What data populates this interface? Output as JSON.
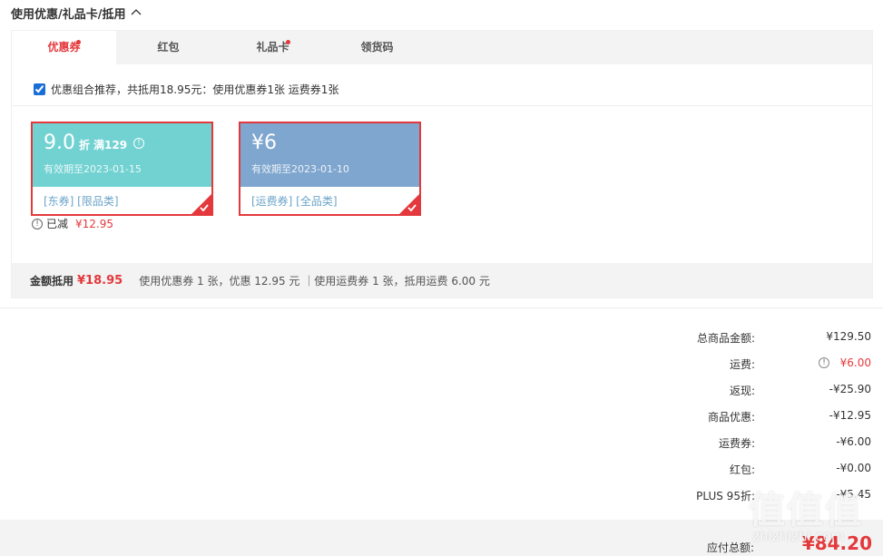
{
  "header": {
    "title": "使用优惠/礼品卡/抵用"
  },
  "tabs": [
    {
      "label": "优惠券",
      "active": true,
      "dot": true
    },
    {
      "label": "红包",
      "active": false,
      "dot": false
    },
    {
      "label": "礼品卡",
      "active": false,
      "dot": true
    },
    {
      "label": "领货码",
      "active": false,
      "dot": false
    }
  ],
  "combo": {
    "checked": true,
    "text": "优惠组合推荐，共抵用18.95元：使用优惠券1张 运费券1张"
  },
  "coupons": [
    {
      "amount": "9.0",
      "unit": "折",
      "condition": "满129",
      "valid": "有效期至2023-01-15",
      "tags": "[东券]  [限品类]",
      "color": "#72d2d2",
      "selected": true
    },
    {
      "amount": "¥6",
      "unit": "",
      "condition": "",
      "valid": "有效期至2023-01-10",
      "tags": "[运费券]  [全品类]",
      "color": "#7fa6cf",
      "selected": true
    }
  ],
  "reduced": {
    "label": "已减",
    "amount": "¥12.95"
  },
  "summary": {
    "label": "金额抵用",
    "value": "¥18.95",
    "detail": "使用优惠券 1 张，优惠 12.95 元 ｜使用运费券 1 张，抵用运费 6.00 元"
  },
  "totals": [
    {
      "label": "总商品金额:",
      "value": "¥129.50"
    },
    {
      "label": "运费:",
      "value": "¥6.00",
      "orange": true,
      "warn": true
    },
    {
      "label": "返现:",
      "value": "-¥25.90"
    },
    {
      "label": "商品优惠:",
      "value": "-¥12.95"
    },
    {
      "label": "运费券:",
      "value": "-¥6.00"
    },
    {
      "label": "红包:",
      "value": "-¥0.00"
    },
    {
      "label": "PLUS 95折:",
      "value": "-¥5.45"
    }
  ],
  "payable": {
    "label": "应付总额:",
    "value": "¥84.20"
  },
  "watermark": {
    "logo": "值值值",
    "url": "zhizhizhi.com"
  },
  "colors": {
    "accent": "#e4393c",
    "tab_bg": "#f3f3f3",
    "tag_text": "#6aa4c8"
  }
}
